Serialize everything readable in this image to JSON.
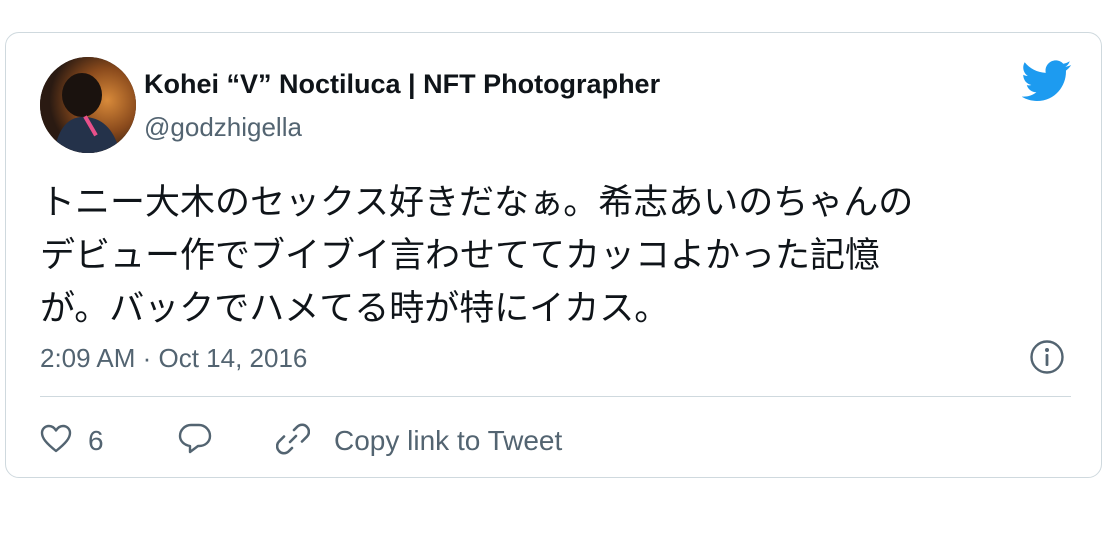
{
  "tweet": {
    "author": {
      "display_name": "Kohei “V” Noctiluca | NFT Photographer",
      "handle": "@godzhigella"
    },
    "text": "トニー大木のセックス好きだなぁ。希志あいのちゃんの\nデビュー作でブイブイ言わせててカッコよかった記憶\nが。バックでハメてる時が特にイカス。",
    "timestamp": "2:09 AM · Oct 14, 2016",
    "like_count": "6",
    "copy_link_label": "Copy link to Tweet"
  },
  "colors": {
    "brand": "#1d9bf0",
    "secondary_text": "#536471",
    "border": "#cfd9de"
  },
  "icons": [
    "twitter-bird-icon",
    "info-icon",
    "heart-icon",
    "reply-icon",
    "link-icon"
  ]
}
